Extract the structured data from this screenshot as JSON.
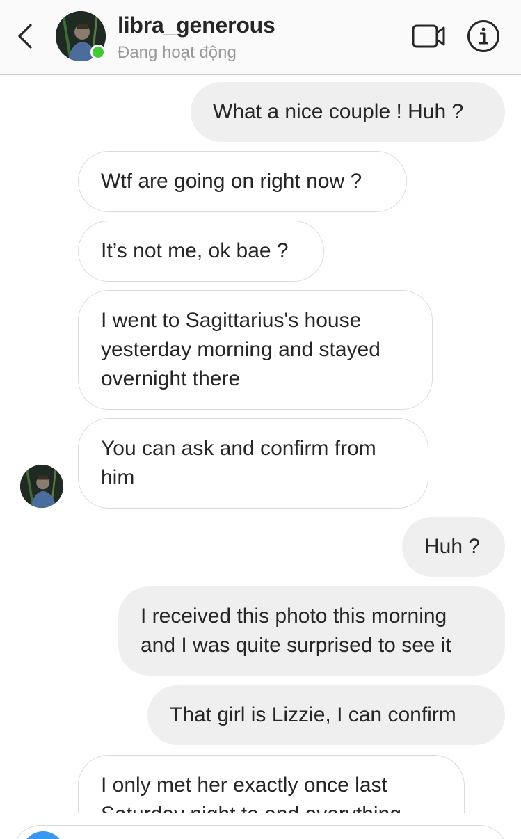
{
  "header": {
    "back_icon": "chevron-left-icon",
    "username": "libra_generous",
    "status": "Đang hoạt động",
    "video_icon": "video-camera-icon",
    "info_icon": "info-icon",
    "online_color": "#44c838"
  },
  "messages": [
    {
      "from": "me",
      "lines": [
        "What a nice couple ! Huh ?"
      ]
    },
    {
      "from": "them",
      "lines": [
        "Wtf are going on right now ?"
      ]
    },
    {
      "from": "them",
      "lines": [
        "It’s not me, ok bae ?"
      ]
    },
    {
      "from": "them",
      "lines": [
        "I went to Sagittarius's house",
        "yesterday morning and stayed",
        "overnight there"
      ]
    },
    {
      "from": "them",
      "lines": [
        "You can ask and confirm from",
        "him"
      ]
    },
    {
      "from": "me",
      "lines": [
        "Huh ?"
      ]
    },
    {
      "from": "me",
      "lines": [
        "I received this photo this morning",
        "and I was quite surprised to see it"
      ]
    },
    {
      "from": "me",
      "lines": [
        "That girl is Lizzie, I can confirm"
      ]
    },
    {
      "from": "them",
      "lines": [
        "I only met her exactly once last",
        "Saturday night to end everything"
      ]
    }
  ],
  "composer": {
    "camera_icon": "camera-icon",
    "accent_color": "#3897f0"
  }
}
